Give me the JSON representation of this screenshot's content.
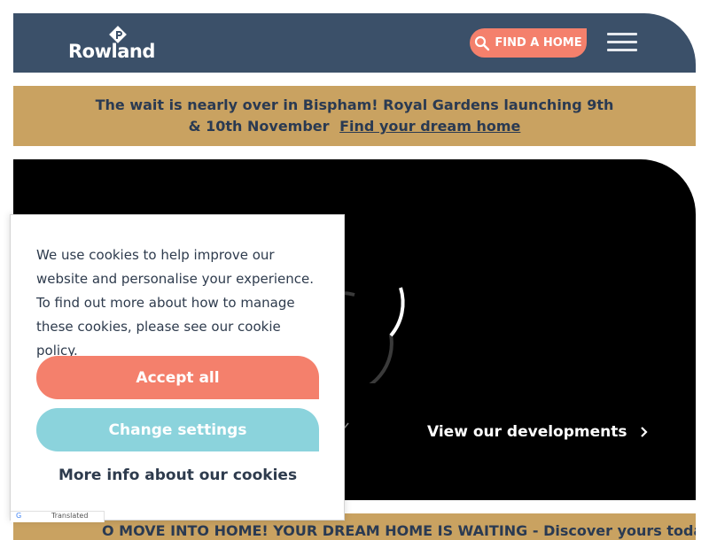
{
  "header": {
    "logo_text": "Rowland",
    "find_home_label": "FIND A HOME",
    "icons": {
      "search": "search-icon",
      "menu": "hamburger-menu-icon",
      "logo": "rowland-logo-icon"
    }
  },
  "announcement": {
    "text": "The wait is nearly over in Bispham! Royal Gardens launching 9th & 10th November",
    "link_label": "Find your dream home"
  },
  "hero": {
    "link_label": "View our developments"
  },
  "second_banner": {
    "text": "O MOVE INTO HOME! YOUR DREAM HOME IS WAITING - Discover yours today"
  },
  "cookie_banner": {
    "text": "We use cookies to help improve our website and personalise your experience. To find out more about how to manage these cookies, please see our cookie policy.",
    "accept_label": "Accept all",
    "settings_label": "Change settings",
    "more_info_label": "More info about our cookies",
    "badge_text": "Translated"
  },
  "colors": {
    "header_bg": "#3b5069",
    "accent": "#f4806c",
    "gold": "#c9a261",
    "teal": "#8bd3dc",
    "text_dark": "#2a3a52"
  }
}
